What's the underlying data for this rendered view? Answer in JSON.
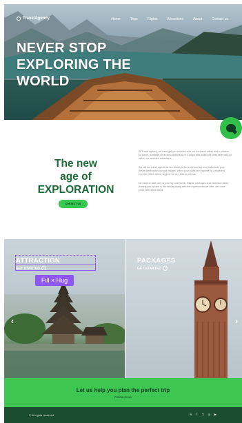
{
  "nav": {
    "logo": "TravelAgency",
    "items": [
      "Home",
      "Trips",
      "Flights",
      "Attractions",
      "About",
      "Contact us"
    ]
  },
  "hero": {
    "title_line1": "NEVER STOP",
    "title_line2": "EXPLORING THE",
    "title_line3": "WORLD"
  },
  "intro": {
    "title_line1": "The new",
    "title_line2": "age of",
    "title_line3": "EXPLORATION",
    "button": "CONTACT US",
    "paragraphs": [
      "At Travel Agency, we have got you covered with our exclusive offers and a passion for travel, available on a self-catered stay in Europe with added off-peak fares and all within our selected attractions.",
      "We tell our travel agents as our clients to be a planned service that meets your dream destination on your budget. When your plans are inspired by a business traveller this is all the support we are able to provide.",
      "No need to take care of your trip ourselves. Flights, packages and exclusive deals, leaving you to take in the holiday along with the experiences we offer, all in one place with a few clicks."
    ]
  },
  "cards": {
    "left": {
      "title": "ATTRACTION",
      "link": "GET STARTED"
    },
    "right": {
      "title": "PACKAGES",
      "link": "GET STARTED"
    },
    "selection_label": "Fill × Hug"
  },
  "cta": {
    "title": "Let us help you plan the perfect trip",
    "link": "Follow more"
  },
  "footer": {
    "copyright": "© All rights reserved",
    "social": [
      "in",
      "f",
      "X",
      "◎",
      "▶"
    ]
  },
  "colors": {
    "brand_green": "#3ec653",
    "dark_green": "#1b4d2f",
    "title_green": "#1c6a3a",
    "selection_purple": "#8e58f0"
  }
}
